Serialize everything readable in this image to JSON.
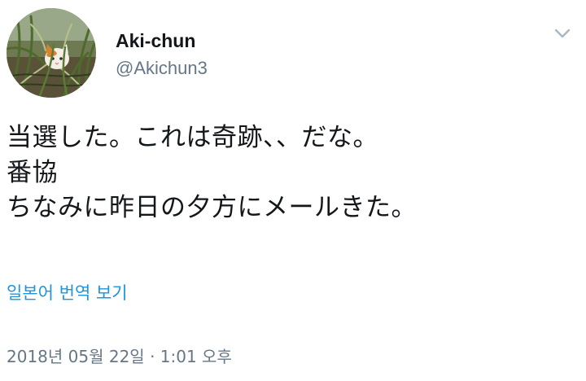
{
  "user": {
    "display_name": "Aki-chun",
    "handle": "@Akichun3",
    "avatar_icon": "cat-in-grass-avatar"
  },
  "menu": {
    "icon": "chevron-down-icon"
  },
  "tweet": {
    "lines": [
      "当選した。これは奇跡、、だな。",
      "番協",
      "ちなみに昨日の夕方にメールきた。"
    ],
    "translate_label": "일본어 번역 보기",
    "timestamp": "2018년 05월 22일 · 1:01 오후"
  },
  "colors": {
    "text": "#14171a",
    "secondary": "#657786",
    "link": "#1b95e0",
    "chevron": "#aab8c2"
  }
}
